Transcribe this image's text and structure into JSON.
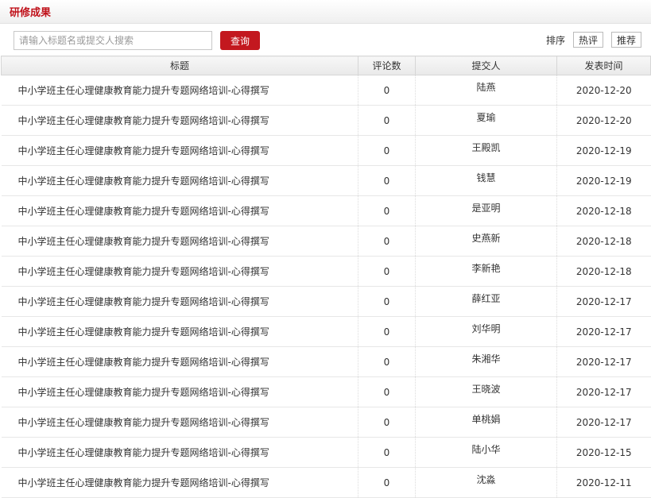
{
  "header": {
    "title": "研修成果"
  },
  "search": {
    "placeholder": "请输入标题名或提交人搜索",
    "value": "",
    "button_label": "查询"
  },
  "sort": {
    "label": "排序",
    "options": [
      "热评",
      "推荐"
    ]
  },
  "table": {
    "columns": [
      "标题",
      "评论数",
      "提交人",
      "发表时间"
    ],
    "rows": [
      {
        "title": "中小学班主任心理健康教育能力提升专题网络培训-心得撰写",
        "comments": "0",
        "submitter": "陆燕",
        "date": "2020-12-20"
      },
      {
        "title": "中小学班主任心理健康教育能力提升专题网络培训-心得撰写",
        "comments": "0",
        "submitter": "夏瑜",
        "date": "2020-12-20"
      },
      {
        "title": "中小学班主任心理健康教育能力提升专题网络培训-心得撰写",
        "comments": "0",
        "submitter": "王殿凯",
        "date": "2020-12-19"
      },
      {
        "title": "中小学班主任心理健康教育能力提升专题网络培训-心得撰写",
        "comments": "0",
        "submitter": "钱慧",
        "date": "2020-12-19"
      },
      {
        "title": "中小学班主任心理健康教育能力提升专题网络培训-心得撰写",
        "comments": "0",
        "submitter": "是亚明",
        "date": "2020-12-18"
      },
      {
        "title": "中小学班主任心理健康教育能力提升专题网络培训-心得撰写",
        "comments": "0",
        "submitter": "史燕新",
        "date": "2020-12-18"
      },
      {
        "title": "中小学班主任心理健康教育能力提升专题网络培训-心得撰写",
        "comments": "0",
        "submitter": "李新艳",
        "date": "2020-12-18"
      },
      {
        "title": "中小学班主任心理健康教育能力提升专题网络培训-心得撰写",
        "comments": "0",
        "submitter": "薛红亚",
        "date": "2020-12-17"
      },
      {
        "title": "中小学班主任心理健康教育能力提升专题网络培训-心得撰写",
        "comments": "0",
        "submitter": "刘华明",
        "date": "2020-12-17"
      },
      {
        "title": "中小学班主任心理健康教育能力提升专题网络培训-心得撰写",
        "comments": "0",
        "submitter": "朱湘华",
        "date": "2020-12-17"
      },
      {
        "title": "中小学班主任心理健康教育能力提升专题网络培训-心得撰写",
        "comments": "0",
        "submitter": "王晓波",
        "date": "2020-12-17"
      },
      {
        "title": "中小学班主任心理健康教育能力提升专题网络培训-心得撰写",
        "comments": "0",
        "submitter": "单桃娟",
        "date": "2020-12-17"
      },
      {
        "title": "中小学班主任心理健康教育能力提升专题网络培训-心得撰写",
        "comments": "0",
        "submitter": "陆小华",
        "date": "2020-12-15"
      },
      {
        "title": "中小学班主任心理健康教育能力提升专题网络培训-心得撰写",
        "comments": "0",
        "submitter": "沈淼",
        "date": "2020-12-11"
      }
    ]
  }
}
